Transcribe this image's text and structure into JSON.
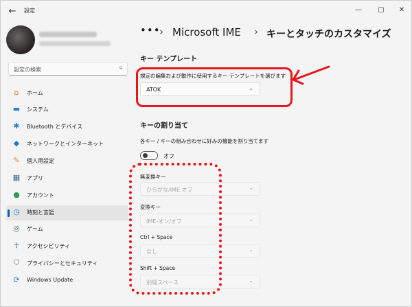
{
  "window": {
    "title": "設定",
    "back_icon": "←",
    "min_icon": "—",
    "max_icon": "▢",
    "close_icon": "✕"
  },
  "search": {
    "placeholder": "設定の検索",
    "icon": "⌕"
  },
  "sidebar": {
    "items": [
      {
        "label": "ホーム",
        "icon": "⌂",
        "color": "#d07a3a"
      },
      {
        "label": "システム",
        "icon": "▬",
        "color": "#1f7fd4"
      },
      {
        "label": "Bluetooth とデバイス",
        "icon": "✱",
        "color": "#1f7fd4"
      },
      {
        "label": "ネットワークとインターネット",
        "icon": "◆",
        "color": "#1c7ad1"
      },
      {
        "label": "個人用設定",
        "icon": "✎",
        "color": "#e0883a"
      },
      {
        "label": "アプリ",
        "icon": "▦",
        "color": "#4a6d8c"
      },
      {
        "label": "アカウント",
        "icon": "●",
        "color": "#2e9a5a"
      },
      {
        "label": "時刻と言語",
        "icon": "◷",
        "color": "#1f7fd4"
      },
      {
        "label": "ゲーム",
        "icon": "◎",
        "color": "#5b6f80"
      },
      {
        "label": "アクセシビリティ",
        "icon": "☥",
        "color": "#1868b8"
      },
      {
        "label": "プライバシーとセキュリティ",
        "icon": "⛉",
        "color": "#5e6e7c"
      },
      {
        "label": "Windows Update",
        "icon": "⟳",
        "color": "#1f7fd4"
      }
    ]
  },
  "breadcrumb": {
    "dots": "•••",
    "sep": "›",
    "parent": "Microsoft IME",
    "current": "キーとタッチのカスタマイズ"
  },
  "key_template": {
    "heading": "キー テンプレート",
    "description": "規定の編集および動作に使用するキー テンプレートを選びます",
    "value": "ATOK",
    "chevron": "⌄"
  },
  "key_assign": {
    "heading": "キーの割り当て",
    "description": "各キー / キーの組み合わせに好みの機能を割り当てます",
    "toggle_label": "オフ",
    "items": [
      {
        "label": "無変換キー",
        "value": "ひらがな/IME オフ"
      },
      {
        "label": "変換キー",
        "value": "IME-オン/オフ"
      },
      {
        "label": "Ctrl + Space",
        "value": "なし"
      },
      {
        "label": "Shift + Space",
        "value": "別幅スペース"
      }
    ]
  },
  "colors": {
    "accent": "#005fb8",
    "annotation": "#e8161c"
  }
}
